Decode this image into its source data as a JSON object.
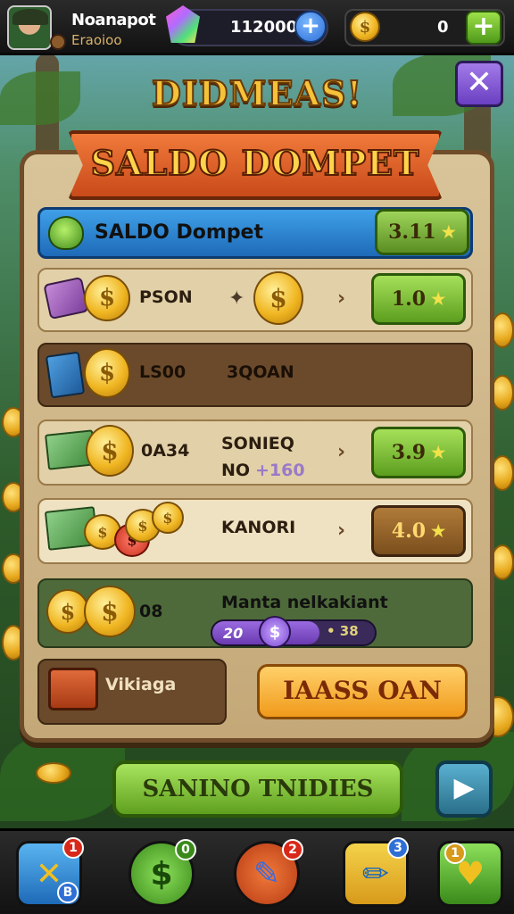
{
  "header": {
    "player_name": "Noanapot",
    "player_subtitle": "Eraoioo",
    "gems_value": "112000",
    "coins_value": "0"
  },
  "title": "DIDMEAS!",
  "panel": {
    "ribbon_title": "SALDO DOMPET",
    "balance_row": {
      "label": "SALDO Dompet",
      "value": "3.11"
    },
    "rows": [
      {
        "label": "PSON",
        "button": "1.0"
      },
      {
        "label": "LS00",
        "label2": "3QOAN"
      },
      {
        "label": "0A34",
        "label2": "SONIEQ",
        "label3": "NO",
        "label4": "+160",
        "button": "3.9"
      },
      {
        "label": "KANORI",
        "button": "4.0"
      }
    ],
    "mission": {
      "coin_count": "08",
      "label": "Manta nelkakiant",
      "pill_left": "20",
      "pill_coin": "$",
      "pill_right": "• 38"
    },
    "chest_label": "Vikiaga",
    "claim_label": "IAASS OAN"
  },
  "footer": {
    "main_button": "SANINO TNIDIES"
  },
  "bottom_nav": [
    {
      "icon": "cross-swords-icon",
      "badge": "1",
      "badge2": "B"
    },
    {
      "icon": "dollar-coin-icon",
      "badge": "0"
    },
    {
      "icon": "pencil-shield-icon",
      "badge": "2"
    },
    {
      "icon": "pencil-icon",
      "badge": "3"
    },
    {
      "icon": "heart-icon",
      "badge": "1"
    }
  ],
  "colors": {
    "accent_green": "#5c9e1e",
    "accent_orange": "#f09a1a",
    "panel_bg": "#d9c49a",
    "ribbon": "#e0602a",
    "gold": "#f0b622"
  }
}
